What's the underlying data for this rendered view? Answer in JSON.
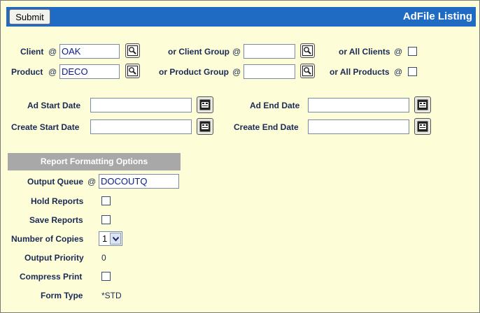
{
  "header": {
    "submit_label": "Submit",
    "title": "AdFile Listing"
  },
  "selection": {
    "client_label": "Client",
    "client_at": "@",
    "client_value": "OAK",
    "client_group_label": "or Client Group",
    "client_group_at": "@",
    "client_group_value": "",
    "all_clients_label": "or All Clients",
    "all_clients_at": "@",
    "all_clients_checked": false,
    "product_label": "Product",
    "product_at": "@",
    "product_value": "DECO",
    "product_group_label": "or Product Group",
    "product_group_at": "@",
    "product_group_value": "",
    "all_products_label": "or All Products",
    "all_products_at": "@",
    "all_products_checked": false
  },
  "dates": {
    "ad_start_label": "Ad Start Date",
    "ad_start_value": "",
    "ad_end_label": "Ad End Date",
    "ad_end_value": "",
    "create_start_label": "Create Start Date",
    "create_start_value": "",
    "create_end_label": "Create End Date",
    "create_end_value": ""
  },
  "report": {
    "section_title": "Report Formatting Options",
    "output_queue_label": "Output Queue",
    "output_queue_at": "@",
    "output_queue_value": "DOCOUTQ",
    "hold_reports_label": "Hold Reports",
    "hold_reports_checked": false,
    "save_reports_label": "Save Reports",
    "save_reports_checked": false,
    "copies_label": "Number of Copies",
    "copies_value": "1",
    "priority_label": "Output Priority",
    "priority_value": "0",
    "compress_label": "Compress Print",
    "compress_checked": false,
    "form_type_label": "Form Type",
    "form_type_value": "*STD"
  },
  "icons": {
    "lookup": "magnifier-lookup-icon",
    "calendar": "calendar-icon",
    "dropdown": "chevron-down-icon"
  },
  "colors": {
    "page_bg": "#fdfdd8",
    "header_bg": "#1f6bc4",
    "section_bg": "#a8a8a8",
    "label_text": "#1a2a55",
    "input_text": "#0a1a88"
  }
}
